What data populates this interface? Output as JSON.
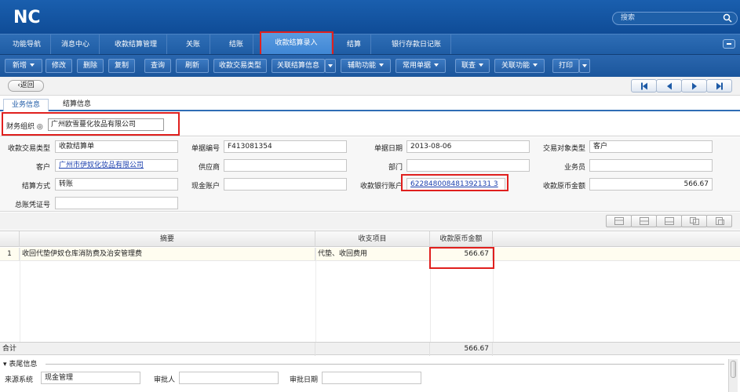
{
  "header": {
    "logo_text": "NC",
    "search_placeholder": "搜索"
  },
  "nav": {
    "items": [
      "功能导航",
      "消息中心",
      "收款结算管理",
      "关账",
      "结账",
      "收款结算录入",
      "结算",
      "银行存款日记账"
    ],
    "active": "收款结算录入"
  },
  "toolbar": {
    "buttons": [
      "新增",
      "修改",
      "删除",
      "复制",
      "查询",
      "刷新",
      "收款交易类型",
      "关联结算信息",
      "辅助功能",
      "常用单据",
      "联查",
      "关联功能",
      "打印"
    ]
  },
  "backbar": {
    "back_label": "返回"
  },
  "tabs": [
    "业务信息",
    "结算信息"
  ],
  "org": {
    "label": "财务组织",
    "value": "广州欧雪蔓化妆品有限公司"
  },
  "form": {
    "trade_type_label": "收款交易类型",
    "trade_type_value": "收款结算单",
    "bill_no_label": "单据编号",
    "bill_no_value": "F413081354",
    "bill_date_label": "单据日期",
    "bill_date_value": "2013-08-06",
    "party_type_label": "交易对象类型",
    "party_type_value": "客户",
    "customer_label": "客户",
    "customer_value": "广州市伊奴化妆品有限公司",
    "supplier_label": "供应商",
    "supplier_value": "",
    "dept_label": "部门",
    "dept_value": "",
    "salesman_label": "业务员",
    "salesman_value": "",
    "settle_method_label": "结算方式",
    "settle_method_value": "转账",
    "cash_account_label": "现金账户",
    "cash_account_value": "",
    "bank_account_label": "收款银行账户",
    "bank_account_value": "622848008481392131 3",
    "orig_amount_label": "收款原币金额",
    "orig_amount_value": "566.67",
    "voucher_label": "总账凭证号",
    "voucher_value": ""
  },
  "grid": {
    "headers": [
      "摘要",
      "收支项目",
      "收款原币金额"
    ],
    "rows": [
      {
        "no": "1",
        "summary": "收回代垫伊奴仓库消防费及治安管理费",
        "item": "代垫、收回费用",
        "amount": "566.67"
      }
    ],
    "total_label": "合计",
    "total_amount": "566.67"
  },
  "footer": {
    "title": "表尾信息",
    "source_label": "来源系统",
    "source_value": "现金管理",
    "approver_label": "审批人",
    "approver_value": "",
    "approve_date_label": "审批日期",
    "approve_date_value": ""
  },
  "colors": {
    "header_blue": "#0f4c97",
    "highlight_red": "#e0201e",
    "link_blue": "#1b3fae"
  }
}
